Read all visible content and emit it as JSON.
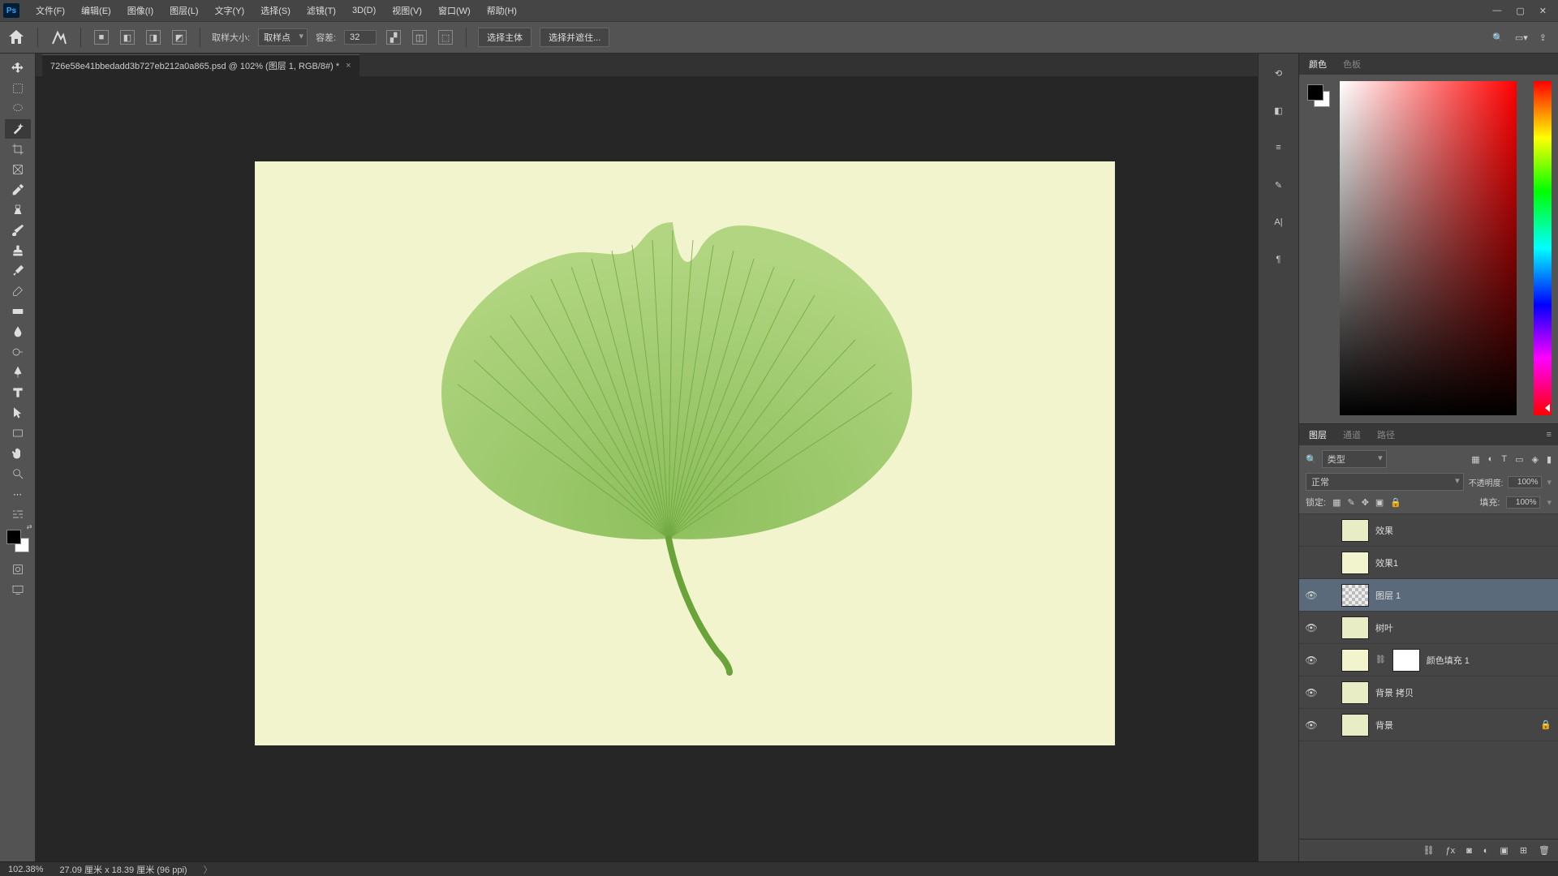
{
  "app": {
    "logo": "Ps"
  },
  "menu": {
    "file": "文件(F)",
    "edit": "编辑(E)",
    "image": "图像(I)",
    "layer": "图层(L)",
    "type": "文字(Y)",
    "select": "选择(S)",
    "filter": "滤镜(T)",
    "threed": "3D(D)",
    "view": "视图(V)",
    "window": "窗口(W)",
    "help": "帮助(H)"
  },
  "options": {
    "sample_size_label": "取样大小:",
    "sample_size_value": "取样点",
    "tolerance_label": "容差:",
    "tolerance_value": "32",
    "select_subject": "选择主体",
    "select_mask": "选择并遮住..."
  },
  "document": {
    "tab_title": "726e58e41bbedadd3b727eb212a0a865.psd @ 102% (图层 1, RGB/8#) *"
  },
  "color_panel": {
    "tab_color": "颜色",
    "tab_swatches": "色板"
  },
  "layers_panel": {
    "tab_layers": "图层",
    "tab_channels": "通道",
    "tab_paths": "路径",
    "kind_label": "类型",
    "blend_mode": "正常",
    "opacity_label": "不透明度:",
    "opacity_value": "100%",
    "lock_label": "锁定:",
    "fill_label": "填充:",
    "fill_value": "100%",
    "layers": [
      {
        "name": "效果",
        "visible": false,
        "thumb": "leafth",
        "selected": false
      },
      {
        "name": "效果1",
        "visible": false,
        "thumb": "cream",
        "selected": false
      },
      {
        "name": "图层 1",
        "visible": true,
        "thumb": "checker",
        "selected": true
      },
      {
        "name": "树叶",
        "visible": true,
        "thumb": "leafth",
        "selected": false
      },
      {
        "name": "颜色填充 1",
        "visible": true,
        "thumb": "cream",
        "mask": "white",
        "linked": true,
        "selected": false
      },
      {
        "name": "背景 拷贝",
        "visible": true,
        "thumb": "leafth",
        "selected": false
      },
      {
        "name": "背景",
        "visible": true,
        "thumb": "leafth",
        "locked": true,
        "selected": false
      }
    ]
  },
  "status": {
    "zoom": "102.38%",
    "dims": "27.09 厘米 x 18.39 厘米 (96 ppi)"
  }
}
